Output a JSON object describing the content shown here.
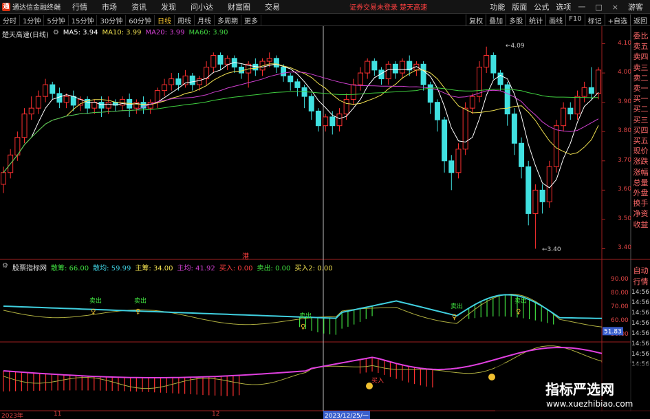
{
  "window": {
    "app_name": "通达信金融终端",
    "notice": "证券交易未登录  楚天高速",
    "menu": [
      "行情",
      "市场",
      "资讯",
      "发现",
      "问小达",
      "财富圈",
      "交易"
    ],
    "right_menu": [
      "功能",
      "版面",
      "公式",
      "选项"
    ],
    "window_controls": [
      "一",
      "□",
      "×"
    ],
    "guest": "游客"
  },
  "toolbar": {
    "periods": [
      "分时",
      "1分钟",
      "5分钟",
      "15分钟",
      "30分钟",
      "60分钟",
      "日线",
      "周线",
      "月线",
      "多周期",
      "更多"
    ],
    "active_period": "日线",
    "tools": [
      "复权",
      "叠加",
      "多股",
      "统计",
      "画线",
      "F10",
      "标记",
      "+自选",
      "返回"
    ]
  },
  "main_panel": {
    "title": "楚天高速(日线)",
    "ma": [
      {
        "label": "MA5: 3.94",
        "color": "#ffffff"
      },
      {
        "label": "MA10: 3.99",
        "color": "#f0e050"
      },
      {
        "label": "MA20: 3.99",
        "color": "#d040d0"
      },
      {
        "label": "MA60: 3.90",
        "color": "#40d040"
      }
    ],
    "price_axis": [
      "4.10",
      "4.00",
      "3.90",
      "3.80",
      "3.70",
      "3.60",
      "3.50",
      "3.40"
    ],
    "high_marker": "4.09",
    "low_marker": "3.40",
    "event_marker": "港"
  },
  "indicator_panel": {
    "title": "股票指标网",
    "items": [
      {
        "label": "散筹: 66.00",
        "color": "#40e040"
      },
      {
        "label": "散均: 59.99",
        "color": "#40d0e0"
      },
      {
        "label": "主筹: 34.00",
        "color": "#f0e050"
      },
      {
        "label": "主均: 41.92",
        "color": "#d040d0"
      },
      {
        "label": "买入: 0.00",
        "color": "#ff4040"
      },
      {
        "label": "卖出: 0.00",
        "color": "#40e040"
      },
      {
        "label": "买入2: 0.00",
        "color": "#f0e050"
      }
    ],
    "axis": [
      "90.00",
      "80.00",
      "70.00",
      "60.00",
      "50.00"
    ],
    "current_value": "51.83",
    "sell_signal": "卖出",
    "buy_signal": "买入"
  },
  "side_panel": {
    "items": [
      "委比",
      "卖五",
      "卖四",
      "卖三",
      "卖二",
      "卖一",
      "买一",
      "买二",
      "买三",
      "买四",
      "买五",
      "现价",
      "涨跌",
      "涨幅",
      "总量",
      "外盘",
      "换手",
      "净资",
      "收益"
    ],
    "items2": [
      "自动",
      "行情"
    ],
    "times": [
      "14:56",
      "14:56",
      "14:56",
      "14:56",
      "14:56",
      "14:56",
      "14:56",
      "14:56"
    ]
  },
  "date_axis": {
    "labels": [
      "2023年",
      "11",
      "12"
    ],
    "current": "2023/12/25/一"
  },
  "watermark": {
    "title": "指标严选网",
    "url": "www.xuezhibiao.com"
  },
  "chart_data": {
    "type": "candlestick",
    "price_range": [
      3.38,
      4.12
    ],
    "candles": [
      [
        3.62,
        3.66,
        3.59,
        3.68
      ],
      [
        3.66,
        3.72,
        3.64,
        3.74
      ],
      [
        3.72,
        3.78,
        3.7,
        3.8
      ],
      [
        3.78,
        3.86,
        3.76,
        3.88
      ],
      [
        3.86,
        3.88,
        3.84,
        3.92
      ],
      [
        3.88,
        3.92,
        3.86,
        3.94
      ],
      [
        3.92,
        3.96,
        3.9,
        3.98
      ],
      [
        3.96,
        3.93,
        3.91,
        3.97
      ],
      [
        3.93,
        3.9,
        3.88,
        3.95
      ],
      [
        3.9,
        3.92,
        3.88,
        3.93
      ],
      [
        3.92,
        3.89,
        3.87,
        3.94
      ],
      [
        3.89,
        3.91,
        3.87,
        3.92
      ],
      [
        3.91,
        3.88,
        3.86,
        3.92
      ],
      [
        3.88,
        3.9,
        3.86,
        3.91
      ],
      [
        3.9,
        3.88,
        3.85,
        3.92
      ],
      [
        3.88,
        3.9,
        3.86,
        3.92
      ],
      [
        3.9,
        3.89,
        3.87,
        3.91
      ],
      [
        3.89,
        3.91,
        3.87,
        3.92
      ],
      [
        3.91,
        3.88,
        3.85,
        3.93
      ],
      [
        3.88,
        3.9,
        3.86,
        3.91
      ],
      [
        3.9,
        3.88,
        3.86,
        3.92
      ],
      [
        3.88,
        3.9,
        3.86,
        3.91
      ],
      [
        3.9,
        3.94,
        3.88,
        3.95
      ],
      [
        3.94,
        3.96,
        3.92,
        3.98
      ],
      [
        3.96,
        3.98,
        3.94,
        4.0
      ],
      [
        3.98,
        3.96,
        3.94,
        4.0
      ],
      [
        3.96,
        3.99,
        3.95,
        4.01
      ],
      [
        3.99,
        3.96,
        3.94,
        4.0
      ],
      [
        3.96,
        3.98,
        3.94,
        3.99
      ],
      [
        3.98,
        4.02,
        3.96,
        4.04
      ],
      [
        4.02,
        4.06,
        4.0,
        4.07
      ],
      [
        4.06,
        4.03,
        4.01,
        4.07
      ],
      [
        4.03,
        4.05,
        4.01,
        4.06
      ],
      [
        4.05,
        4.02,
        4.0,
        4.06
      ],
      [
        4.02,
        4.0,
        3.98,
        4.03
      ],
      [
        4.0,
        4.03,
        3.95,
        4.04
      ],
      [
        4.03,
        4.01,
        3.99,
        4.05
      ],
      [
        4.01,
        4.04,
        3.99,
        4.05
      ],
      [
        4.04,
        4.05,
        4.02,
        4.07
      ],
      [
        4.05,
        4.02,
        4.0,
        4.06
      ],
      [
        4.02,
        3.99,
        3.97,
        4.03
      ],
      [
        3.99,
        3.97,
        3.94,
        4.0
      ],
      [
        3.97,
        3.95,
        3.92,
        3.98
      ],
      [
        3.95,
        3.92,
        3.88,
        3.96
      ],
      [
        3.92,
        3.87,
        3.84,
        3.93
      ],
      [
        3.87,
        3.82,
        3.8,
        3.88
      ],
      [
        3.82,
        3.85,
        3.8,
        3.86
      ],
      [
        3.85,
        3.82,
        3.79,
        3.87
      ],
      [
        3.82,
        3.86,
        3.8,
        3.88
      ],
      [
        3.86,
        3.91,
        3.84,
        3.93
      ],
      [
        3.91,
        3.96,
        3.89,
        3.98
      ],
      [
        3.96,
        4.0,
        3.94,
        4.02
      ],
      [
        4.0,
        4.04,
        3.98,
        4.05
      ],
      [
        4.04,
        4.01,
        3.99,
        4.05
      ],
      [
        4.01,
        3.98,
        3.96,
        4.02
      ],
      [
        3.98,
        4.03,
        3.96,
        4.04
      ],
      [
        4.03,
        4.0,
        3.98,
        4.04
      ],
      [
        4.0,
        4.04,
        3.98,
        4.05
      ],
      [
        4.04,
        4.01,
        3.99,
        4.06
      ],
      [
        4.01,
        4.03,
        3.99,
        4.04
      ],
      [
        4.03,
        3.96,
        3.94,
        4.04
      ],
      [
        3.96,
        3.9,
        3.86,
        3.97
      ],
      [
        3.9,
        3.84,
        3.8,
        3.91
      ],
      [
        3.84,
        3.7,
        3.66,
        3.85
      ],
      [
        3.7,
        3.66,
        3.6,
        3.72
      ],
      [
        3.66,
        3.74,
        3.64,
        3.76
      ],
      [
        3.74,
        3.88,
        3.72,
        3.9
      ],
      [
        3.88,
        3.92,
        3.86,
        3.93
      ],
      [
        3.92,
        4.02,
        3.9,
        4.04
      ],
      [
        4.02,
        4.06,
        4.0,
        4.09
      ],
      [
        4.06,
        4.0,
        3.98,
        4.07
      ],
      [
        4.0,
        3.96,
        3.94,
        4.01
      ],
      [
        3.96,
        3.86,
        3.82,
        3.97
      ],
      [
        3.86,
        3.76,
        3.72,
        3.88
      ],
      [
        3.76,
        3.68,
        3.64,
        3.78
      ],
      [
        3.68,
        3.52,
        3.48,
        3.7
      ],
      [
        3.52,
        3.6,
        3.4,
        3.62
      ],
      [
        3.6,
        3.56,
        3.52,
        3.62
      ],
      [
        3.56,
        3.68,
        3.54,
        3.7
      ],
      [
        3.68,
        3.82,
        3.66,
        3.84
      ],
      [
        3.82,
        3.88,
        3.8,
        3.9
      ],
      [
        3.88,
        3.86,
        3.84,
        3.9
      ],
      [
        3.86,
        3.92,
        3.84,
        3.94
      ],
      [
        3.92,
        3.95,
        3.9,
        3.97
      ],
      [
        3.95,
        3.93,
        3.91,
        4.02
      ],
      [
        3.93,
        4.01,
        3.91,
        4.02
      ]
    ]
  }
}
